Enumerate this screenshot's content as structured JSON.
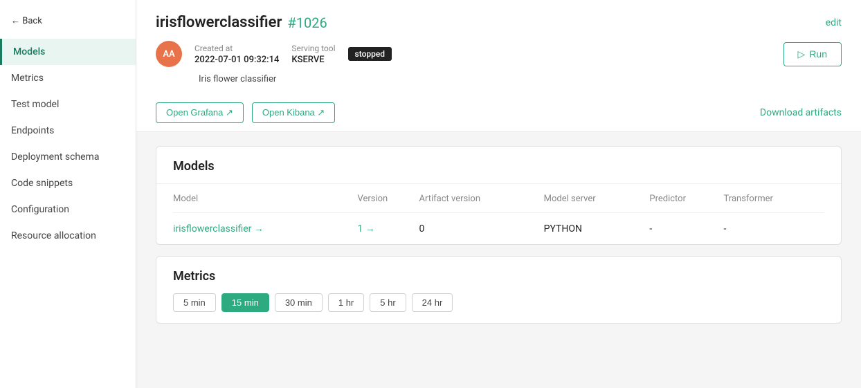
{
  "sidebar": {
    "back_label": "← Back",
    "items": [
      {
        "id": "models",
        "label": "Models",
        "active": true
      },
      {
        "id": "metrics",
        "label": "Metrics",
        "active": false
      },
      {
        "id": "test-model",
        "label": "Test model",
        "active": false
      },
      {
        "id": "endpoints",
        "label": "Endpoints",
        "active": false
      },
      {
        "id": "deployment-schema",
        "label": "Deployment schema",
        "active": false
      },
      {
        "id": "code-snippets",
        "label": "Code snippets",
        "active": false
      },
      {
        "id": "configuration",
        "label": "Configuration",
        "active": false
      },
      {
        "id": "resource-allocation",
        "label": "Resource allocation",
        "active": false
      }
    ]
  },
  "header": {
    "model_name": "irisflowerclassifier",
    "model_id": "#1026",
    "edit_label": "edit",
    "avatar_text": "AA",
    "created_at_label": "Created at",
    "created_at_value": "2022-07-01 09:32:14",
    "serving_tool_label": "Serving tool",
    "serving_tool_value": "KSERVE",
    "status": "stopped",
    "run_label": "Run",
    "description": "Iris flower classifier",
    "open_grafana_label": "Open Grafana ↗",
    "open_kibana_label": "Open Kibana ↗",
    "download_artifacts_label": "Download artifacts"
  },
  "models_card": {
    "title": "Models",
    "columns": [
      "Model",
      "Version",
      "Artifact version",
      "Model server",
      "Predictor",
      "Transformer"
    ],
    "rows": [
      {
        "model": "irisflowerclassifier →",
        "model_href": true,
        "version": "1 →",
        "version_href": true,
        "artifact_version": "0",
        "model_server": "PYTHON",
        "predictor": "-",
        "transformer": "-"
      }
    ]
  },
  "metrics_card": {
    "title": "Metrics",
    "time_tabs": [
      {
        "label": "5 min",
        "active": false
      },
      {
        "label": "15 min",
        "active": true
      },
      {
        "label": "30 min",
        "active": false
      },
      {
        "label": "1 hr",
        "active": false
      },
      {
        "label": "5 hr",
        "active": false
      },
      {
        "label": "24 hr",
        "active": false
      }
    ]
  }
}
